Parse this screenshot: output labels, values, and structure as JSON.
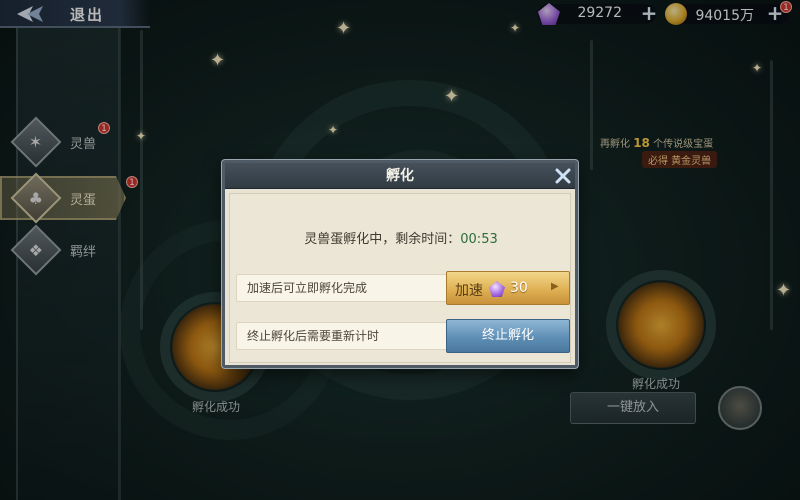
{
  "topbar": {
    "back_label": "退出",
    "gems": "29272",
    "coins": "94015万",
    "coin_badge": "1"
  },
  "side_tabs": [
    {
      "label": "灵兽",
      "badge": "1",
      "icon": "beast-icon"
    },
    {
      "label": "灵蛋",
      "badge": "1",
      "icon": "egg-icon",
      "active": true
    },
    {
      "label": "羁绊",
      "icon": "bond-icon"
    }
  ],
  "promo": {
    "line1_prefix": "再孵化",
    "line1_count": "18",
    "line1_suffix": "个传说级宝蛋",
    "line2": "必得 黄金灵兽"
  },
  "slots": {
    "left_label": "孵化成功",
    "right_label": "孵化成功",
    "oneclick_label": "一键放入"
  },
  "dialog": {
    "title": "孵化",
    "timer_prefix": "灵兽蛋孵化中，剩余时间：",
    "timer_value": "00:53",
    "speed_row_label": "加速后可立即孵化完成",
    "speed_button_label": "加速",
    "speed_cost": "30",
    "stop_row_label": "终止孵化后需要重新计时",
    "stop_button_label": "终止孵化"
  },
  "colors": {
    "dialog_bg": "#e9e3d3",
    "header_bg": "#313b44",
    "speed_button": "#dfb154",
    "stop_button": "#5f8fb6",
    "countdown": "#2d6b3b"
  }
}
